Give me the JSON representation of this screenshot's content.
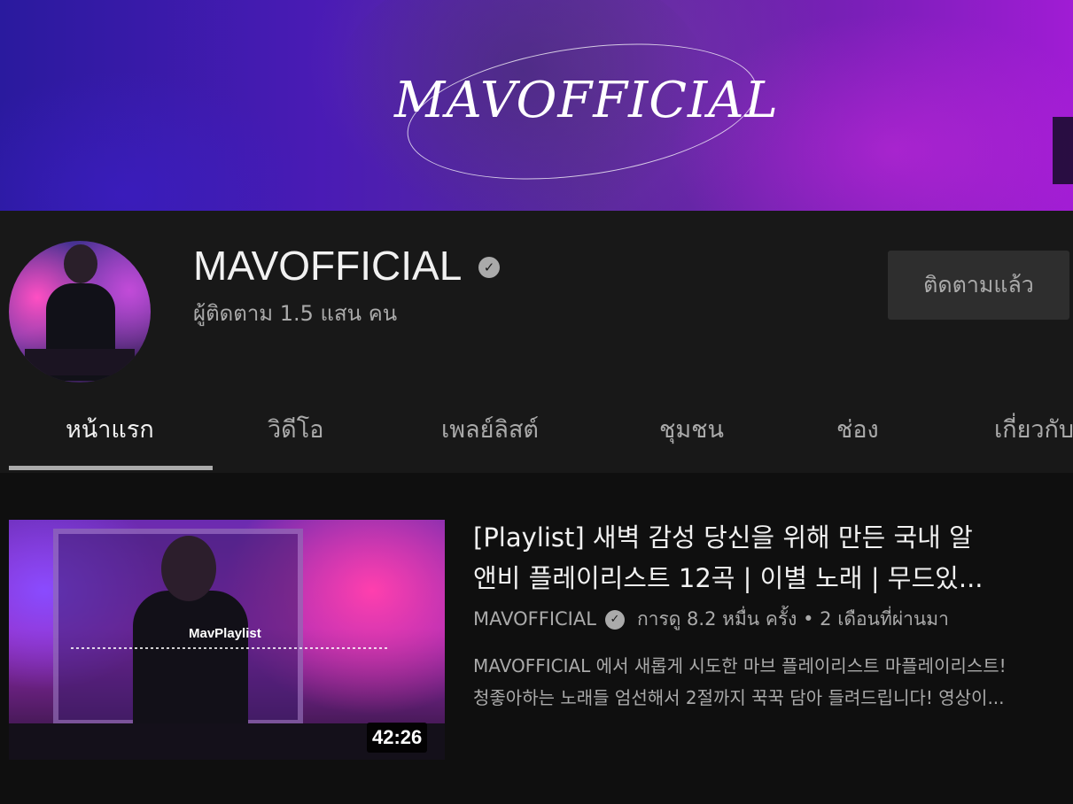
{
  "banner": {
    "logo_text": "MAVOFFICIAL"
  },
  "channel": {
    "name": "MAVOFFICIAL",
    "verified_icon": "verified-check-icon",
    "subscribers": "ผู้ติดตาม 1.5 แสน คน",
    "subscribe_button_label": "ติดตามแล้ว"
  },
  "tabs": [
    {
      "label": "หน้าแรก",
      "active": true
    },
    {
      "label": "วิดีโอ",
      "active": false
    },
    {
      "label": "เพลย์ลิสต์",
      "active": false
    },
    {
      "label": "ชุมชน",
      "active": false
    },
    {
      "label": "ช่อง",
      "active": false
    },
    {
      "label": "เกี่ยวกับ",
      "active": false
    }
  ],
  "video": {
    "thumbnail_text": "MavPlaylist",
    "duration": "42:26",
    "title_line1": "[Playlist] 새벽 감성 당신을 위해 만든 국내 알",
    "title_line2": "앤비 플레이리스트 12곡 | 이별 노래 | 무드있...",
    "channel": "MAVOFFICIAL",
    "stats": "การดู 8.2 หมื่น ครั้ง • 2 เดือนที่ผ่านมา",
    "description_line1": "MAVOFFICIAL 에서 새롭게 시도한 마브 플레이리스트 마플레이리스트!",
    "description_line2": "청좋아하는 노래들 엄선해서 2절까지 꾹꾹 담아 들려드립니다! 영상이..."
  },
  "colors": {
    "background": "#0f0f0f",
    "header_background": "#181818",
    "primary_text": "#f1f1f1",
    "secondary_text": "#aaaaaa"
  }
}
